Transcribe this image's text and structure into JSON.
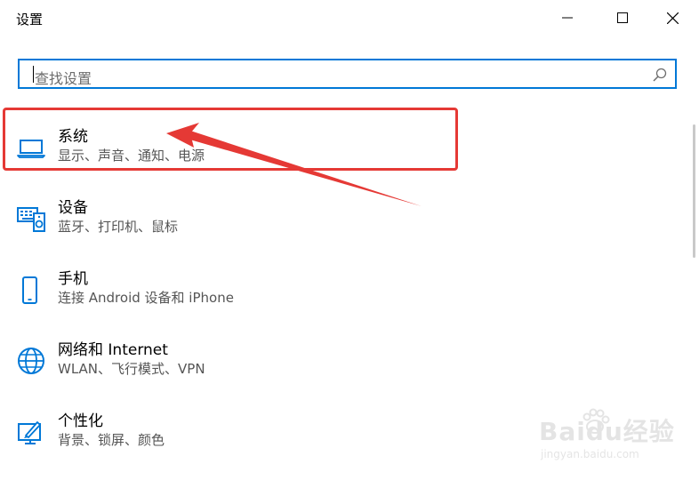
{
  "window": {
    "title": "设置"
  },
  "search": {
    "placeholder": "查找设置"
  },
  "items": [
    {
      "name": "系统",
      "desc": "显示、声音、通知、电源",
      "icon": "laptop-icon"
    },
    {
      "name": "设备",
      "desc": "蓝牙、打印机、鼠标",
      "icon": "devices-icon"
    },
    {
      "name": "手机",
      "desc": "连接 Android 设备和 iPhone",
      "icon": "phone-icon"
    },
    {
      "name": "网络和 Internet",
      "desc": "WLAN、飞行模式、VPN",
      "icon": "globe-icon"
    },
    {
      "name": "个性化",
      "desc": "背景、锁屏、颜色",
      "icon": "personalize-icon"
    }
  ],
  "watermark": {
    "logo": "Baidu经验",
    "sub": "jingyan.baidu.com"
  },
  "colors": {
    "accent": "#0078d7",
    "annotation": "#e53935"
  }
}
